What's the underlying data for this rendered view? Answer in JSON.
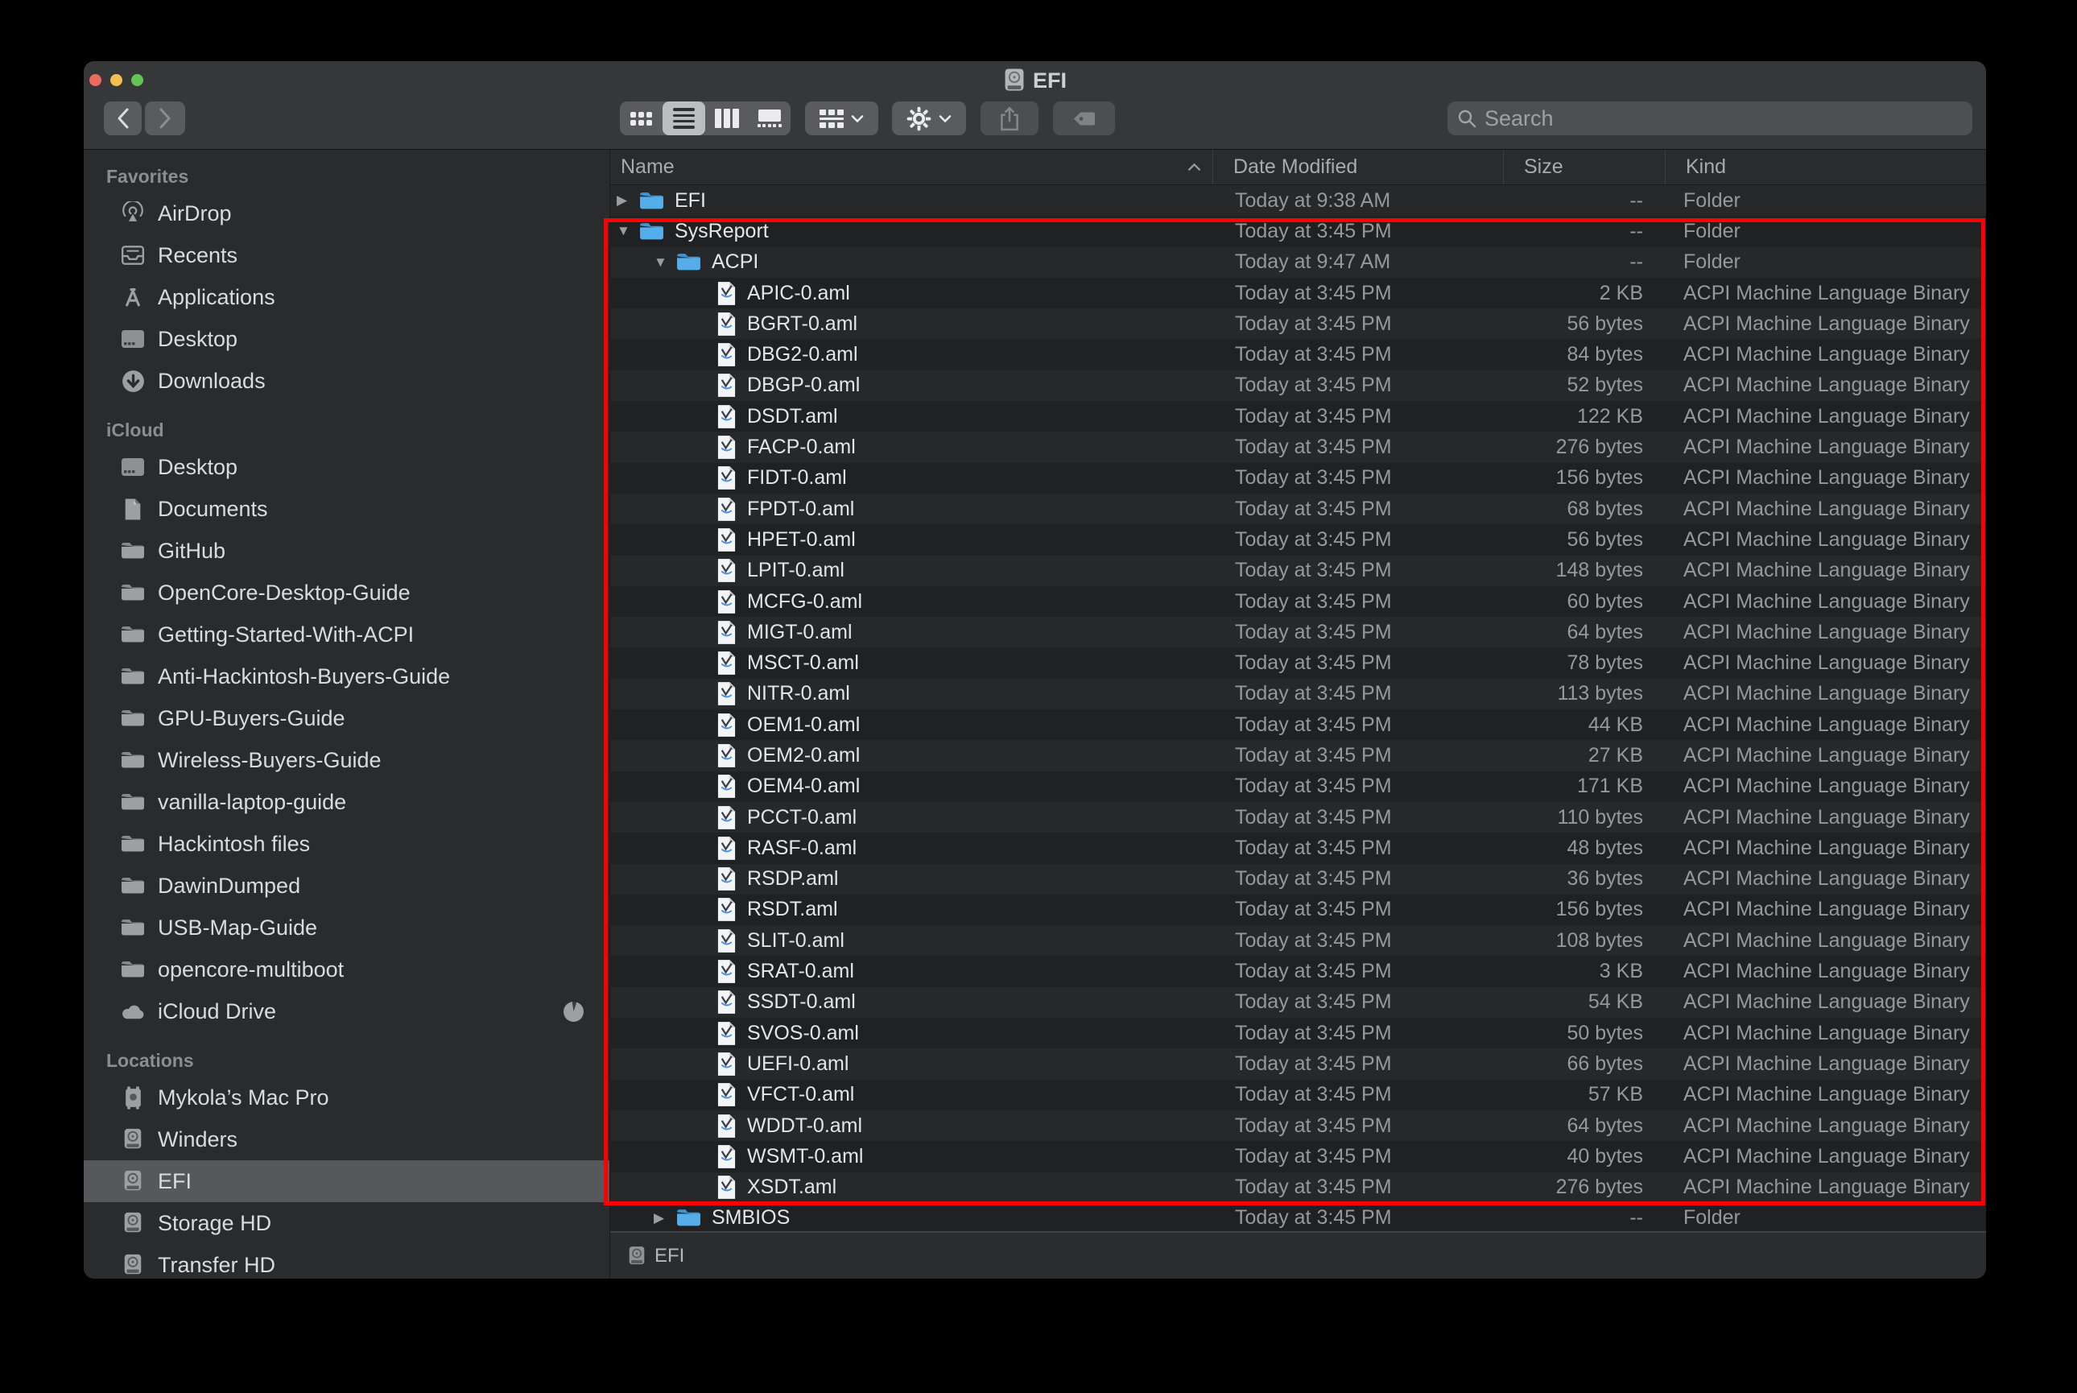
{
  "window": {
    "title": "EFI"
  },
  "toolbar": {
    "search_placeholder": "Search",
    "view_modes": [
      "icons",
      "list",
      "columns",
      "gallery"
    ],
    "selected_view": "list",
    "icons": [
      "back",
      "forward",
      "icon-view",
      "list-view",
      "column-view",
      "gallery-view",
      "group-by",
      "action-gear",
      "share",
      "tag",
      "search",
      "volume"
    ]
  },
  "sidebar": {
    "sections": [
      {
        "title": "Favorites",
        "items": [
          {
            "label": "AirDrop",
            "icon": "airdrop"
          },
          {
            "label": "Recents",
            "icon": "recents"
          },
          {
            "label": "Applications",
            "icon": "applications"
          },
          {
            "label": "Desktop",
            "icon": "desktop"
          },
          {
            "label": "Downloads",
            "icon": "downloads"
          }
        ]
      },
      {
        "title": "iCloud",
        "items": [
          {
            "label": "Desktop",
            "icon": "desktop"
          },
          {
            "label": "Documents",
            "icon": "documents"
          },
          {
            "label": "GitHub",
            "icon": "folder"
          },
          {
            "label": "OpenCore-Desktop-Guide",
            "icon": "folder"
          },
          {
            "label": "Getting-Started-With-ACPI",
            "icon": "folder"
          },
          {
            "label": "Anti-Hackintosh-Buyers-Guide",
            "icon": "folder"
          },
          {
            "label": "GPU-Buyers-Guide",
            "icon": "folder"
          },
          {
            "label": "Wireless-Buyers-Guide",
            "icon": "folder"
          },
          {
            "label": "vanilla-laptop-guide",
            "icon": "folder"
          },
          {
            "label": "Hackintosh files",
            "icon": "folder"
          },
          {
            "label": "DawinDumped",
            "icon": "folder"
          },
          {
            "label": "USB-Map-Guide",
            "icon": "folder"
          },
          {
            "label": "opencore-multiboot",
            "icon": "folder"
          },
          {
            "label": "iCloud Drive",
            "icon": "cloud",
            "progress": true
          }
        ]
      },
      {
        "title": "Locations",
        "items": [
          {
            "label": "Mykola’s Mac Pro",
            "icon": "macpro"
          },
          {
            "label": "Winders",
            "icon": "drive"
          },
          {
            "label": "EFI",
            "icon": "drive",
            "selected": true
          },
          {
            "label": "Storage HD",
            "icon": "drive"
          },
          {
            "label": "Transfer HD",
            "icon": "drive"
          }
        ]
      }
    ]
  },
  "list": {
    "columns": [
      {
        "label": "Name",
        "sort": "asc"
      },
      {
        "label": "Date Modified"
      },
      {
        "label": "Size"
      },
      {
        "label": "Kind"
      }
    ],
    "rows": [
      {
        "level": 0,
        "disclosure": "collapsed",
        "icon": "folder",
        "name": "EFI",
        "date": "Today at 9:38 AM",
        "size": "--",
        "kind": "Folder"
      },
      {
        "level": 0,
        "disclosure": "expanded",
        "icon": "folder",
        "name": "SysReport",
        "date": "Today at 3:45 PM",
        "size": "--",
        "kind": "Folder"
      },
      {
        "level": 1,
        "disclosure": "expanded",
        "icon": "folder",
        "name": "ACPI",
        "date": "Today at 9:47 AM",
        "size": "--",
        "kind": "Folder"
      },
      {
        "level": 2,
        "icon": "aml",
        "name": "APIC-0.aml",
        "date": "Today at 3:45 PM",
        "size": "2 KB",
        "kind": "ACPI Machine Language Binary"
      },
      {
        "level": 2,
        "icon": "aml",
        "name": "BGRT-0.aml",
        "date": "Today at 3:45 PM",
        "size": "56 bytes",
        "kind": "ACPI Machine Language Binary"
      },
      {
        "level": 2,
        "icon": "aml",
        "name": "DBG2-0.aml",
        "date": "Today at 3:45 PM",
        "size": "84 bytes",
        "kind": "ACPI Machine Language Binary"
      },
      {
        "level": 2,
        "icon": "aml",
        "name": "DBGP-0.aml",
        "date": "Today at 3:45 PM",
        "size": "52 bytes",
        "kind": "ACPI Machine Language Binary"
      },
      {
        "level": 2,
        "icon": "aml",
        "name": "DSDT.aml",
        "date": "Today at 3:45 PM",
        "size": "122 KB",
        "kind": "ACPI Machine Language Binary"
      },
      {
        "level": 2,
        "icon": "aml",
        "name": "FACP-0.aml",
        "date": "Today at 3:45 PM",
        "size": "276 bytes",
        "kind": "ACPI Machine Language Binary"
      },
      {
        "level": 2,
        "icon": "aml",
        "name": "FIDT-0.aml",
        "date": "Today at 3:45 PM",
        "size": "156 bytes",
        "kind": "ACPI Machine Language Binary"
      },
      {
        "level": 2,
        "icon": "aml",
        "name": "FPDT-0.aml",
        "date": "Today at 3:45 PM",
        "size": "68 bytes",
        "kind": "ACPI Machine Language Binary"
      },
      {
        "level": 2,
        "icon": "aml",
        "name": "HPET-0.aml",
        "date": "Today at 3:45 PM",
        "size": "56 bytes",
        "kind": "ACPI Machine Language Binary"
      },
      {
        "level": 2,
        "icon": "aml",
        "name": "LPIT-0.aml",
        "date": "Today at 3:45 PM",
        "size": "148 bytes",
        "kind": "ACPI Machine Language Binary"
      },
      {
        "level": 2,
        "icon": "aml",
        "name": "MCFG-0.aml",
        "date": "Today at 3:45 PM",
        "size": "60 bytes",
        "kind": "ACPI Machine Language Binary"
      },
      {
        "level": 2,
        "icon": "aml",
        "name": "MIGT-0.aml",
        "date": "Today at 3:45 PM",
        "size": "64 bytes",
        "kind": "ACPI Machine Language Binary"
      },
      {
        "level": 2,
        "icon": "aml",
        "name": "MSCT-0.aml",
        "date": "Today at 3:45 PM",
        "size": "78 bytes",
        "kind": "ACPI Machine Language Binary"
      },
      {
        "level": 2,
        "icon": "aml",
        "name": "NITR-0.aml",
        "date": "Today at 3:45 PM",
        "size": "113 bytes",
        "kind": "ACPI Machine Language Binary"
      },
      {
        "level": 2,
        "icon": "aml",
        "name": "OEM1-0.aml",
        "date": "Today at 3:45 PM",
        "size": "44 KB",
        "kind": "ACPI Machine Language Binary"
      },
      {
        "level": 2,
        "icon": "aml",
        "name": "OEM2-0.aml",
        "date": "Today at 3:45 PM",
        "size": "27 KB",
        "kind": "ACPI Machine Language Binary"
      },
      {
        "level": 2,
        "icon": "aml",
        "name": "OEM4-0.aml",
        "date": "Today at 3:45 PM",
        "size": "171 KB",
        "kind": "ACPI Machine Language Binary"
      },
      {
        "level": 2,
        "icon": "aml",
        "name": "PCCT-0.aml",
        "date": "Today at 3:45 PM",
        "size": "110 bytes",
        "kind": "ACPI Machine Language Binary"
      },
      {
        "level": 2,
        "icon": "aml",
        "name": "RASF-0.aml",
        "date": "Today at 3:45 PM",
        "size": "48 bytes",
        "kind": "ACPI Machine Language Binary"
      },
      {
        "level": 2,
        "icon": "aml",
        "name": "RSDP.aml",
        "date": "Today at 3:45 PM",
        "size": "36 bytes",
        "kind": "ACPI Machine Language Binary"
      },
      {
        "level": 2,
        "icon": "aml",
        "name": "RSDT.aml",
        "date": "Today at 3:45 PM",
        "size": "156 bytes",
        "kind": "ACPI Machine Language Binary"
      },
      {
        "level": 2,
        "icon": "aml",
        "name": "SLIT-0.aml",
        "date": "Today at 3:45 PM",
        "size": "108 bytes",
        "kind": "ACPI Machine Language Binary"
      },
      {
        "level": 2,
        "icon": "aml",
        "name": "SRAT-0.aml",
        "date": "Today at 3:45 PM",
        "size": "3 KB",
        "kind": "ACPI Machine Language Binary"
      },
      {
        "level": 2,
        "icon": "aml",
        "name": "SSDT-0.aml",
        "date": "Today at 3:45 PM",
        "size": "54 KB",
        "kind": "ACPI Machine Language Binary"
      },
      {
        "level": 2,
        "icon": "aml",
        "name": "SVOS-0.aml",
        "date": "Today at 3:45 PM",
        "size": "50 bytes",
        "kind": "ACPI Machine Language Binary"
      },
      {
        "level": 2,
        "icon": "aml",
        "name": "UEFI-0.aml",
        "date": "Today at 3:45 PM",
        "size": "66 bytes",
        "kind": "ACPI Machine Language Binary"
      },
      {
        "level": 2,
        "icon": "aml",
        "name": "VFCT-0.aml",
        "date": "Today at 3:45 PM",
        "size": "57 KB",
        "kind": "ACPI Machine Language Binary"
      },
      {
        "level": 2,
        "icon": "aml",
        "name": "WDDT-0.aml",
        "date": "Today at 3:45 PM",
        "size": "64 bytes",
        "kind": "ACPI Machine Language Binary"
      },
      {
        "level": 2,
        "icon": "aml",
        "name": "WSMT-0.aml",
        "date": "Today at 3:45 PM",
        "size": "40 bytes",
        "kind": "ACPI Machine Language Binary"
      },
      {
        "level": 2,
        "icon": "aml",
        "name": "XSDT.aml",
        "date": "Today at 3:45 PM",
        "size": "276 bytes",
        "kind": "ACPI Machine Language Binary"
      },
      {
        "level": 1,
        "disclosure": "collapsed",
        "icon": "folder",
        "name": "SMBIOS",
        "date": "Today at 3:45 PM",
        "size": "--",
        "kind": "Folder"
      }
    ]
  },
  "statusbar": {
    "location": "EFI",
    "icon": "drive"
  },
  "annotation": {
    "type": "highlight-rectangle",
    "color": "#ff0000"
  }
}
